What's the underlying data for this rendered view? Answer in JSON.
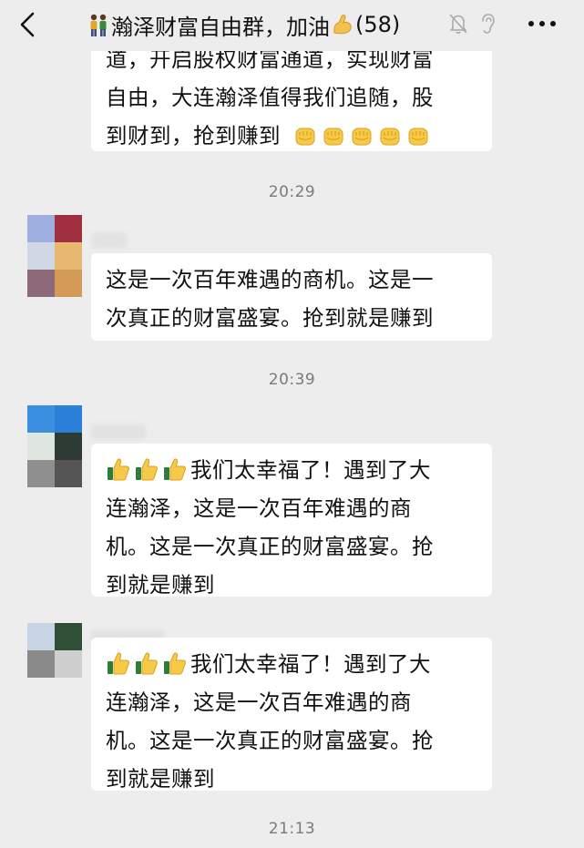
{
  "header": {
    "title": "瀚泽财富自由群，加油",
    "member_count": "(58)",
    "icons": [
      "back-icon",
      "people-icon",
      "flexed-biceps-icon",
      "mute-bell-icon",
      "ear-icon",
      "more-icon"
    ]
  },
  "chat": {
    "messages": [
      {
        "lines": [
          "道，开启股权财富通道，实现财富",
          "自由，大连瀚泽值得我们追随，股"
        ],
        "last_line": "到财到，抢到赚到",
        "trailing_emoji": "raised-fist-icon",
        "trailing_count": 5
      },
      {
        "time": "20:29"
      },
      {
        "lines": [
          "这是一次百年难遇的商机。这是一",
          "次真正的财富盛宴。抢到就是赚到"
        ],
        "avatar_colors": [
          "#9fb0e0",
          "#a03040",
          "#cfd8e4",
          "#e8b870",
          "#8c6a7a",
          "#d49a58"
        ]
      },
      {
        "time": "20:39"
      },
      {
        "first_line": "我们太幸福了！遇到了大",
        "lines": [
          "连瀚泽，这是一次百年难遇的商",
          "机。这是一次真正的财富盛宴。抢",
          "到就是赚到"
        ],
        "leading_emoji": "thumbs-up-icon",
        "leading_count": 3,
        "avatar_colors": [
          "#3a8fe0",
          "#2a7fd8",
          "#dfe6df",
          "#2e3a34",
          "#8f8f8f",
          "#555555"
        ]
      },
      {
        "first_line": "我们太幸福了！遇到了大",
        "lines": [
          "连瀚泽，这是一次百年难遇的商",
          "机。这是一次真正的财富盛宴。抢",
          "到就是赚到"
        ],
        "leading_emoji": "thumbs-up-icon",
        "leading_count": 3,
        "avatar_colors": [
          "#c8d4e4",
          "#2f4f36",
          "#8a8a8a",
          "#cfcfcf",
          "#ededed",
          "#ededed"
        ]
      },
      {
        "time": "21:13"
      }
    ]
  },
  "colors": {
    "background": "#ededed",
    "bubble": "#ffffff",
    "time_text": "#7a7a7a",
    "text": "#111111"
  }
}
